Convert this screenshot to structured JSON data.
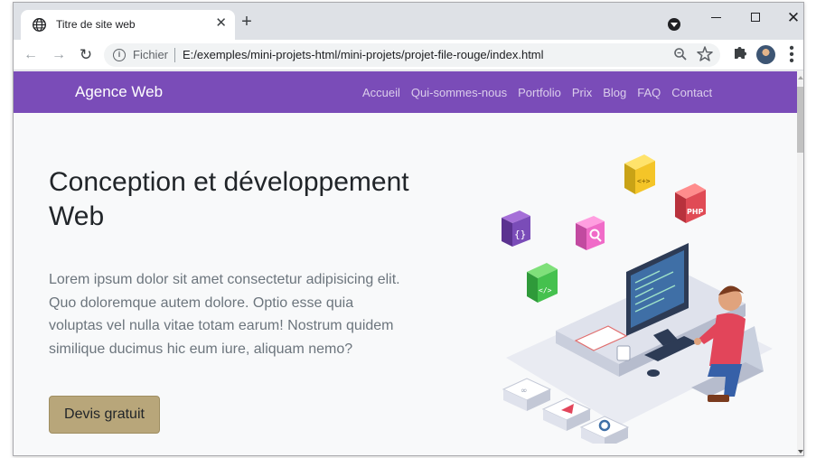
{
  "browser": {
    "tab": {
      "title": "Titre de site web",
      "favicon": "globe-icon",
      "close_glyph": "✕"
    },
    "new_tab_glyph": "+",
    "window_controls": {
      "close_glyph": "✕"
    },
    "toolbar": {
      "back_glyph": "←",
      "forward_glyph": "→",
      "reload_glyph": "↻",
      "scheme_label": "Fichier",
      "url": "E:/exemples/mini-projets-html/mini-projets/projet-file-rouge/index.html",
      "zoom_icon": "zoom-icon",
      "bookmark_icon": "star-icon",
      "extensions_icon": "puzzle-icon",
      "menu_glyph": "⋮"
    }
  },
  "site": {
    "brand": "Agence Web",
    "nav": [
      {
        "label": "Accueil"
      },
      {
        "label": "Qui-sommes-nous"
      },
      {
        "label": "Portfolio"
      },
      {
        "label": "Prix"
      },
      {
        "label": "Blog"
      },
      {
        "label": "FAQ"
      },
      {
        "label": "Contact"
      }
    ],
    "hero": {
      "title": "Conception et développement Web",
      "text": "Lorem ipsum dolor sit amet consectetur adipisicing elit. Quo doloremque autem dolore. Optio esse quia voluptas vel nulla vitae totam earum! Nostrum quidem similique ducimus hic eum iure, aliquam nemo?",
      "cta": "Devis gratuit"
    },
    "illustration": {
      "cube_labels": [
        "{}",
        "</>",
        "<+>",
        "PHP"
      ]
    }
  },
  "colors": {
    "navbar": "#7a4cb8",
    "cta": "#b8a67a",
    "page_background": "#f8f9fa"
  }
}
